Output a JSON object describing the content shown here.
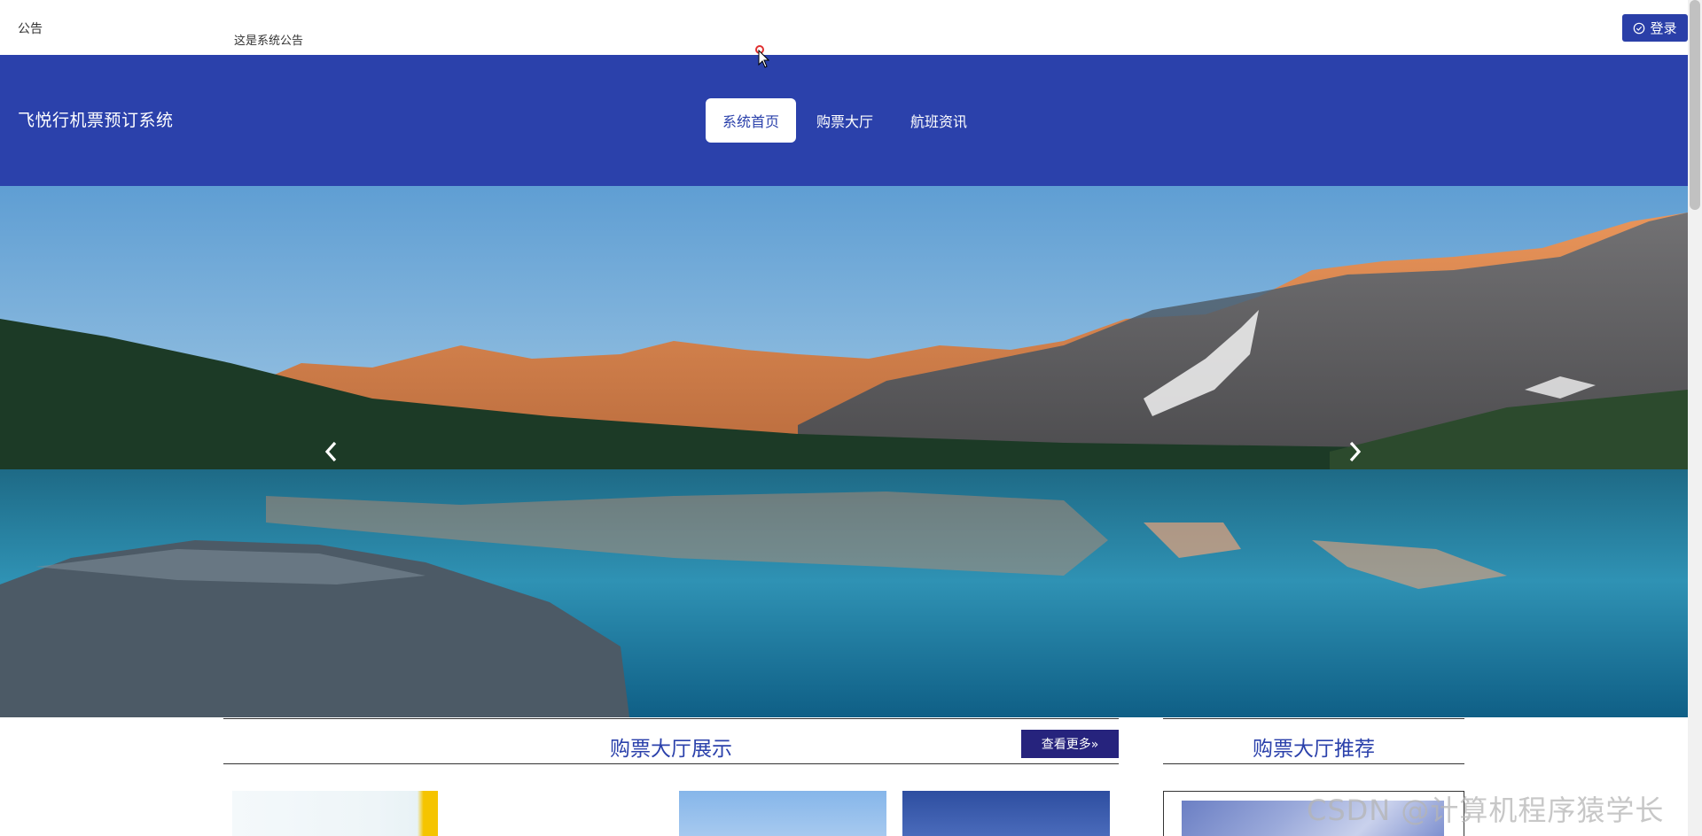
{
  "notice": {
    "title": "公告",
    "text": "这是系统公告"
  },
  "login": {
    "label": "登录",
    "icon": "check-circle-icon"
  },
  "header": {
    "site_title": "飞悦行机票预订系统",
    "nav": [
      {
        "label": "系统首页",
        "active": true
      },
      {
        "label": "购票大厅",
        "active": false
      },
      {
        "label": "航班资讯",
        "active": false
      }
    ]
  },
  "hero": {
    "prev_icon": "chevron-left-icon",
    "next_icon": "chevron-right-icon"
  },
  "sections": {
    "main": {
      "title": "购票大厅展示",
      "more_label": "查看更多»"
    },
    "side": {
      "title": "购票大厅推荐"
    }
  },
  "watermark": "CSDN @计算机程序猿学长",
  "colors": {
    "primary": "#2b41ab",
    "more_button": "#26237d"
  }
}
